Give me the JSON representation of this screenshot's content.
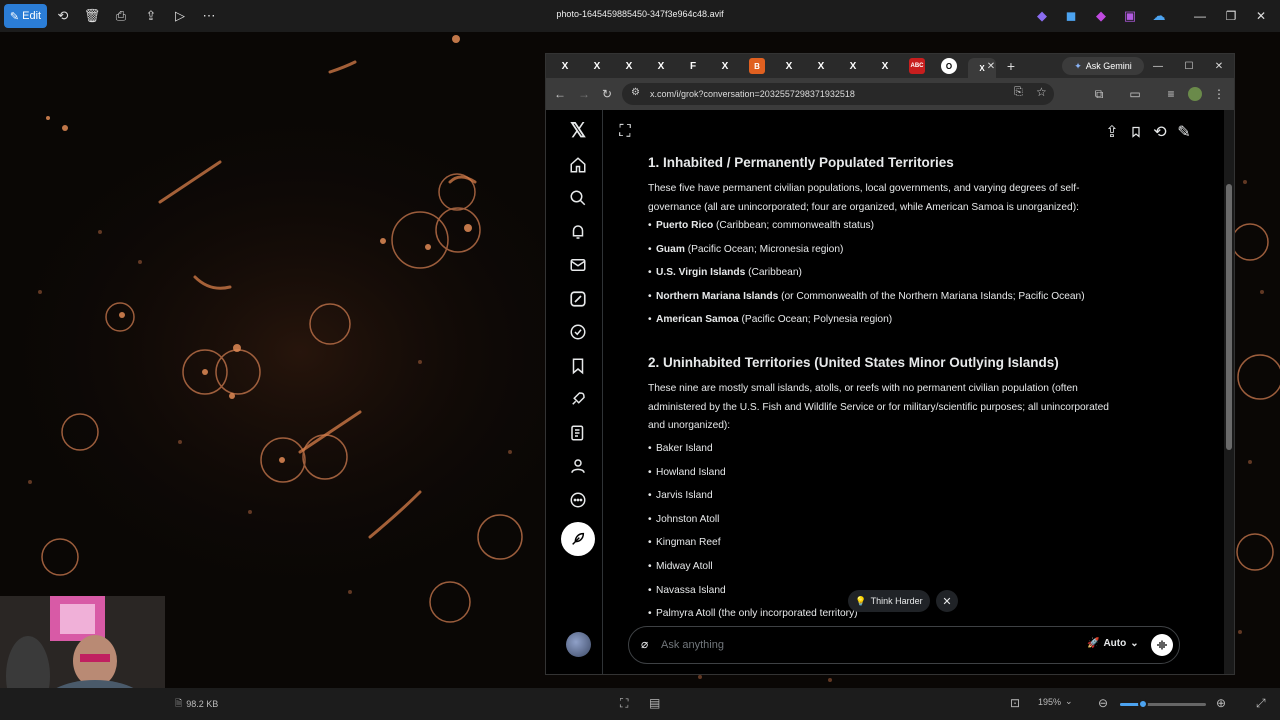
{
  "viewer": {
    "edit_label": "Edit",
    "file_title": "photo-1645459885450-347f3e964c48.avif",
    "file_size": "98.2 KB",
    "zoom_level": "195%",
    "zoom_fraction": 0.27
  },
  "browser": {
    "ask_gemini_label": "Ask Gemini",
    "url": "x.com/i/grok?conversation=2032557298371932518",
    "tabs": [
      "X",
      "X",
      "X",
      "X",
      "F",
      "X",
      "B",
      "X",
      "X",
      "X",
      "X",
      "ABC",
      "O",
      "X"
    ]
  },
  "grok": {
    "section1": {
      "heading": "1. Inhabited / Permanently Populated Territories",
      "intro_line1": "These five have permanent civilian populations, local governments, and varying degrees of self-",
      "intro_line2": "governance (all are unincorporated; four are organized, while American Samoa is unorganized):",
      "items": [
        {
          "name": "Puerto Rico",
          "detail": " (Caribbean; commonwealth status)"
        },
        {
          "name": "Guam",
          "detail": " (Pacific Ocean; Micronesia region)"
        },
        {
          "name": "U.S. Virgin Islands",
          "detail": " (Caribbean)"
        },
        {
          "name": "Northern Mariana Islands",
          "detail": " (or Commonwealth of the Northern Mariana Islands; Pacific Ocean)"
        },
        {
          "name": "American Samoa",
          "detail": " (Pacific Ocean; Polynesia region)"
        }
      ]
    },
    "section2": {
      "heading": "2. Uninhabited Territories (United States Minor Outlying Islands)",
      "intro_line1": "These nine are mostly small islands, atolls, or reefs with no permanent civilian population (often",
      "intro_line2": "administered by the U.S. Fish and Wildlife Service or for military/scientific purposes; all unincorporated",
      "intro_line3": "and unorganized):",
      "items": [
        "Baker Island",
        "Howland Island",
        "Jarvis Island",
        "Johnston Atoll",
        "Kingman Reef",
        "Midway Atoll",
        "Navassa Island",
        "Palmyra Atoll (the only incorporated territory)"
      ]
    },
    "think_harder_label": "Think Harder",
    "input_placeholder": "Ask anything",
    "model_label": "Auto"
  }
}
